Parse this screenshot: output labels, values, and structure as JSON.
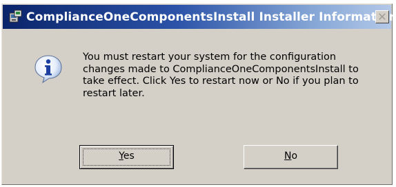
{
  "dialog": {
    "title": "ComplianceOneComponentsInstall Installer Information",
    "close_glyph": "✕",
    "message": "You must restart your system for the configuration changes made to ComplianceOneComponentsInstall to take effect. Click Yes to restart now or No if you plan to restart later.",
    "icon": "info-icon",
    "buttons": {
      "yes_label": "Yes",
      "no_label": "No"
    }
  },
  "colors": {
    "titlebar_start": "#0a246a",
    "titlebar_end": "#b3c8e8",
    "face": "#d4d0c8"
  }
}
